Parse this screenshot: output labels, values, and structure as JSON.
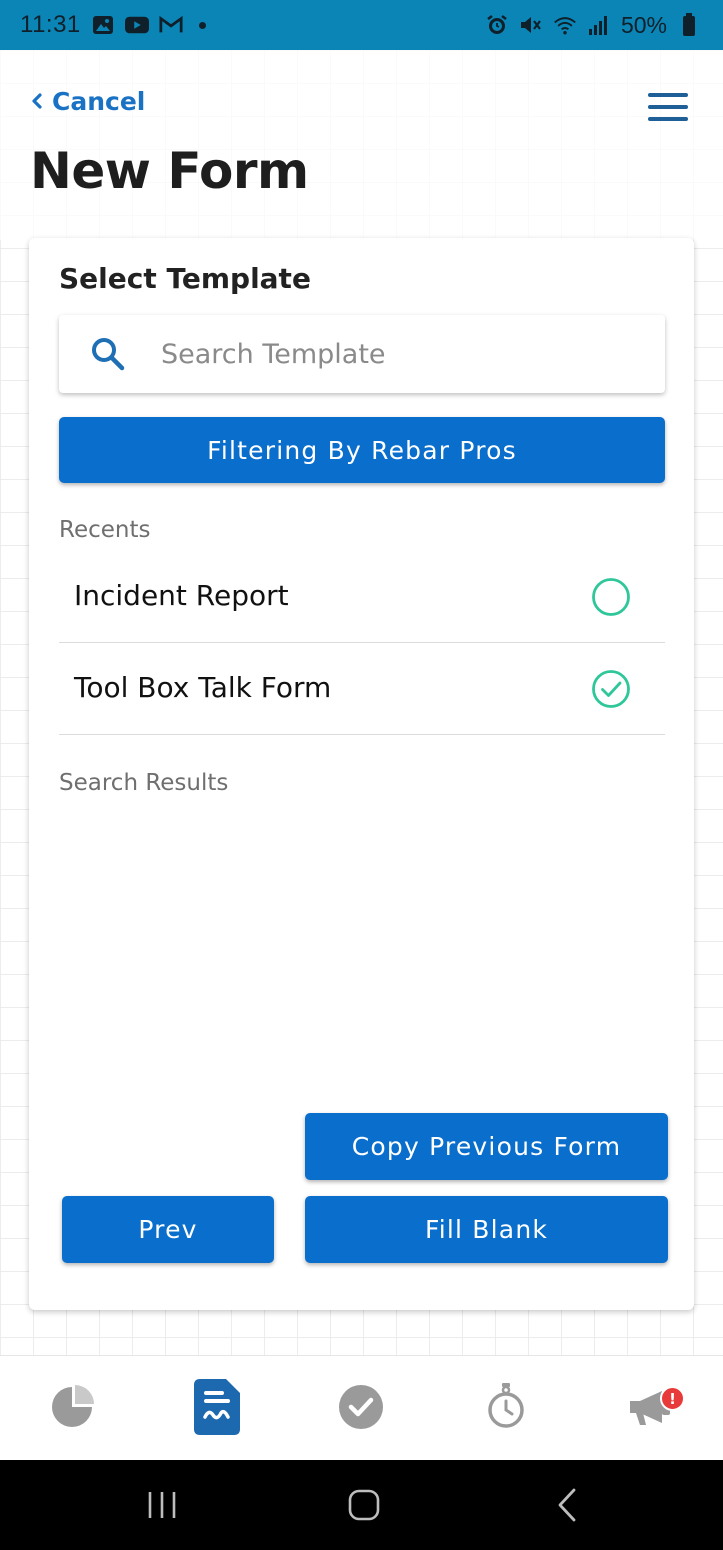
{
  "status_bar": {
    "time": "11:31",
    "battery": "50%"
  },
  "header": {
    "cancel_label": "Cancel",
    "title": "New Form"
  },
  "card": {
    "title": "Select Template",
    "search": {
      "placeholder": "Search Template",
      "value": ""
    },
    "filter_button_label": "Filtering By Rebar Pros",
    "recents_label": "Recents",
    "recents": [
      {
        "label": "Incident Report",
        "selected": false
      },
      {
        "label": "Tool Box Talk Form",
        "selected": true
      }
    ],
    "search_results_label": "Search Results",
    "copy_button_label": "Copy Previous Form",
    "prev_button_label": "Prev",
    "fill_button_label": "Fill Blank"
  },
  "tab_bar": {
    "tabs": [
      {
        "icon": "pie-chart-icon",
        "active": false
      },
      {
        "icon": "form-document-icon",
        "active": true
      },
      {
        "icon": "check-circle-icon",
        "active": false
      },
      {
        "icon": "stopwatch-icon",
        "active": false
      },
      {
        "icon": "megaphone-icon",
        "active": false
      }
    ],
    "notification_badge": "!"
  },
  "colors": {
    "accent": "#0a6ecc",
    "status_bar": "#0a85b5",
    "check_green": "#2fc79a",
    "badge_red": "#e83a3a"
  }
}
